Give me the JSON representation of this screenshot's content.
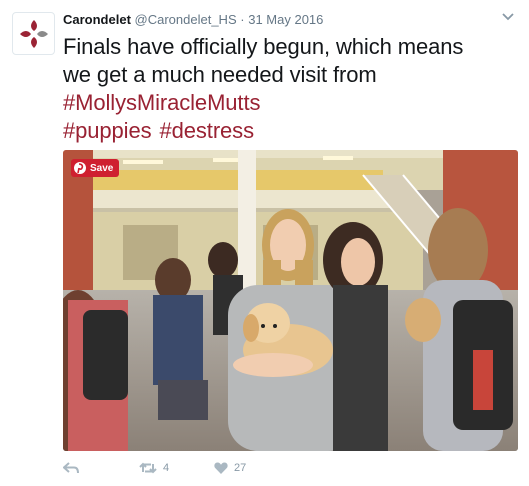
{
  "tweet": {
    "display_name": "Carondelet",
    "handle": "@Carondelet_HS",
    "separator": "·",
    "date": "31 May 2016",
    "text_line1": "Finals have officially begun, which means",
    "text_line2": "we get a much needed visit from",
    "hashtag1": "#MollysMiracleMutts",
    "hashtag2": "#puppies",
    "hashtag3": "#destress"
  },
  "media": {
    "save_label": "Save"
  },
  "actions": {
    "retweet_count": "4",
    "like_count": "27"
  },
  "icons": {
    "avatar": "carondelet-cross-logo",
    "chevron": "chevron-down-icon",
    "reply": "reply-icon",
    "retweet": "retweet-icon",
    "like": "heart-icon",
    "save": "pinterest-icon"
  },
  "colors": {
    "hashtag": "#992233",
    "save_button": "#cf2030",
    "meta_text": "#657786",
    "action_icons": "#aab8c2"
  }
}
